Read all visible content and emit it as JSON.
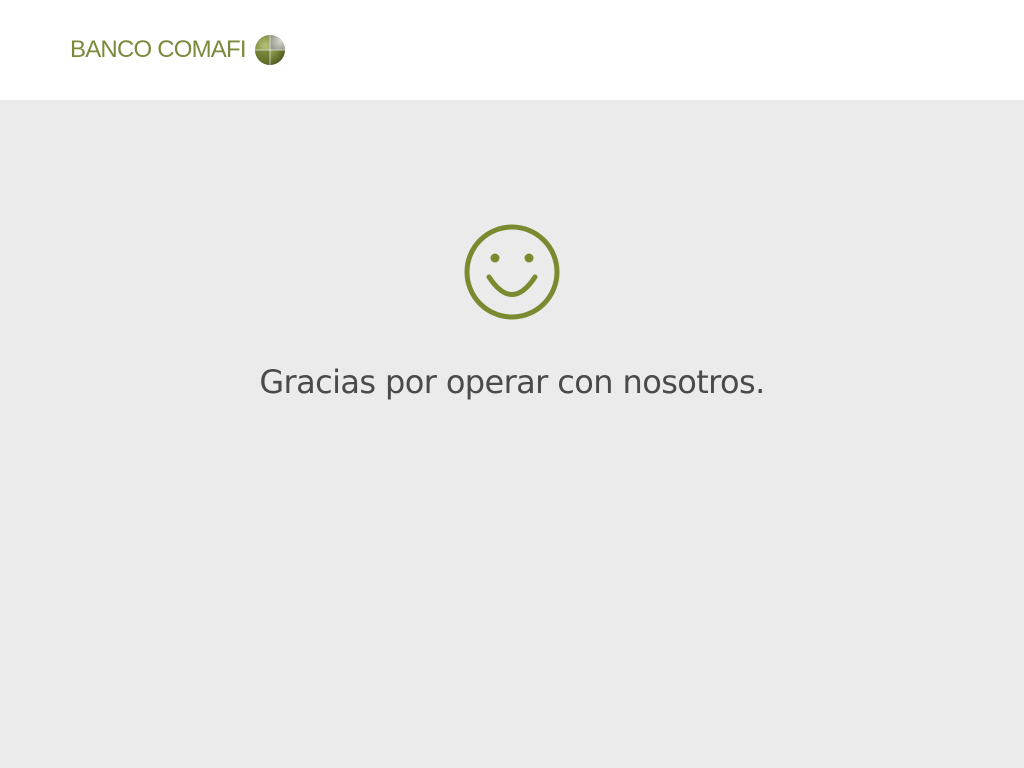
{
  "header": {
    "logo_text": "BANCO COMAFI",
    "logo_icon": "comafi-globe-icon"
  },
  "main": {
    "icon": "smiley-face-icon",
    "message": "Gracias por operar con nosotros."
  },
  "colors": {
    "brand_green": "#7a8a3c",
    "icon_green": "#7a8a2e",
    "background": "#ebebeb",
    "header_background": "#ffffff",
    "text": "#4a4a4a"
  }
}
